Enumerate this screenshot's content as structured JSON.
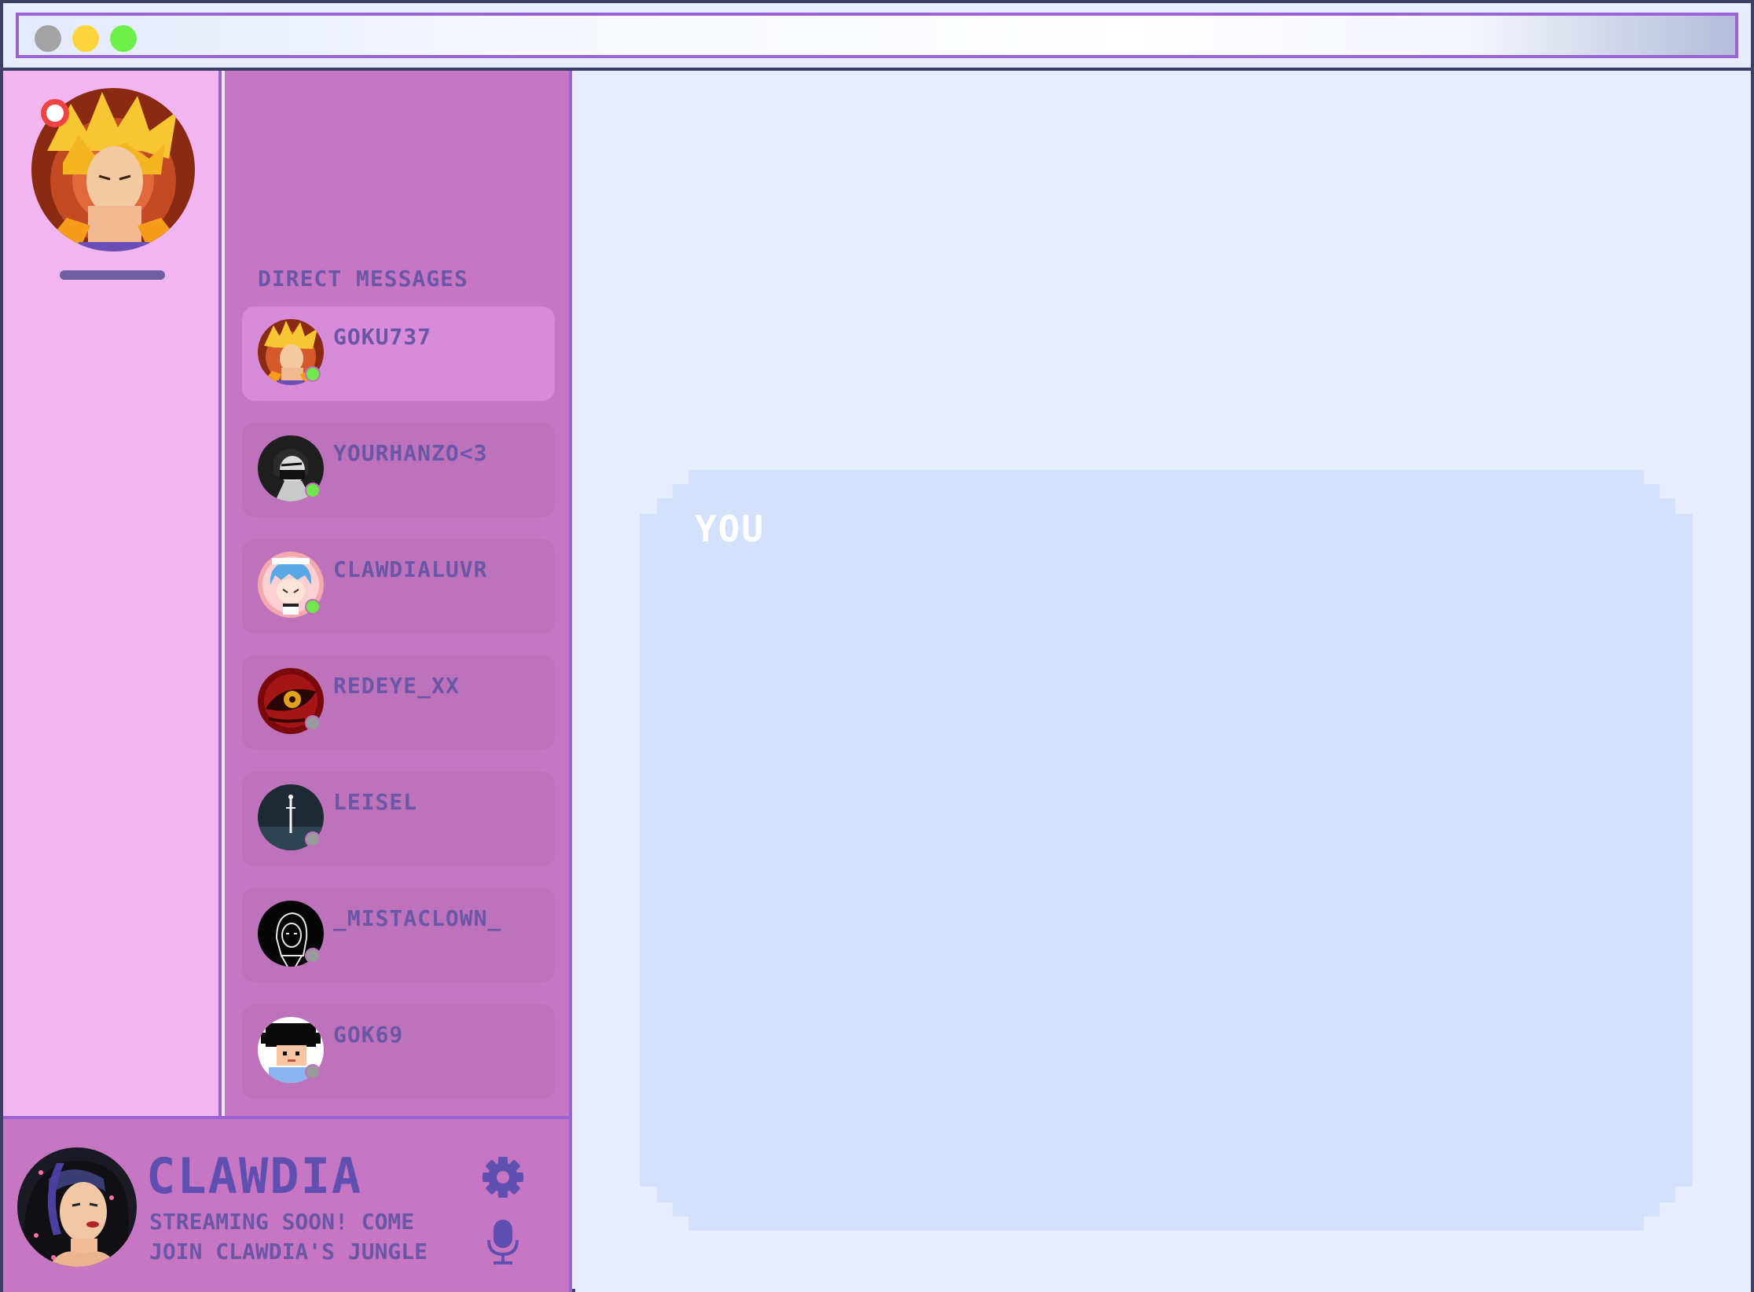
{
  "window": {
    "controls": [
      "grey",
      "yellow",
      "green"
    ]
  },
  "server_rail": {
    "avatar_icon": "spiky-blonde-hair-avatar",
    "has_notification": true
  },
  "dm_panel": {
    "heading": "DIRECT MESSAGES",
    "items": [
      {
        "name": "GOKU737",
        "status": "online",
        "active": true
      },
      {
        "name": "YOURHANZO<3",
        "status": "online",
        "active": false
      },
      {
        "name": "CLAWDIALUVR",
        "status": "online",
        "active": false
      },
      {
        "name": "REDEYE_XX",
        "status": "offline",
        "active": false
      },
      {
        "name": "LEISEL",
        "status": "offline",
        "active": false
      },
      {
        "name": "_MISTACLOWN_",
        "status": "offline",
        "active": false
      },
      {
        "name": "GOK69",
        "status": "offline",
        "active": false
      }
    ]
  },
  "user_panel": {
    "name": "CLAWDIA",
    "status_line": "STREAMING SOON! COME JOIN CLAWDIA'S JUNGLE",
    "settings_icon": "gear-icon",
    "mic_icon": "microphone-icon"
  },
  "chat": {
    "label": "YOU"
  },
  "colors": {
    "rail": "#f1b5f0",
    "panel": "#c776c4",
    "accent": "#9b63d6",
    "text": "#6a56a6",
    "chat_bg": "#d3e1fc",
    "online": "#6ee84a",
    "offline": "#9a9a9a"
  }
}
